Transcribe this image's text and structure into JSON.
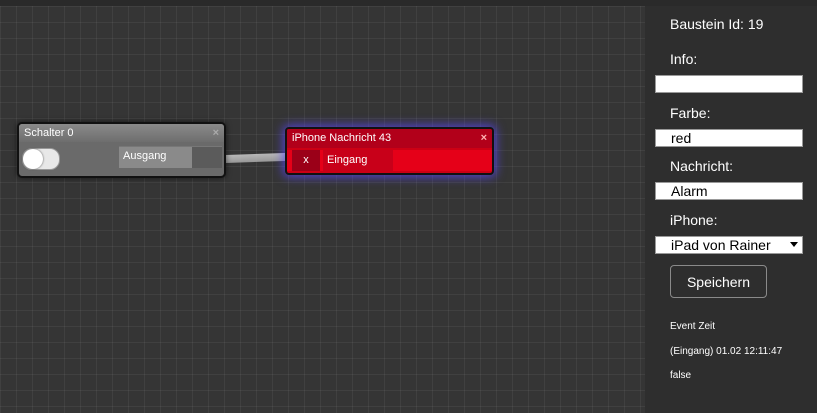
{
  "nodes": {
    "switch": {
      "title": "Schalter 0",
      "close": "×",
      "output_label": "Ausgang",
      "toggle_on": false
    },
    "iphone": {
      "title": "iPhone Nachricht 43",
      "close": "×",
      "remove": "x",
      "input_label": "Eingang"
    }
  },
  "panel": {
    "block_id": "Baustein Id: 19",
    "info_label": "Info:",
    "info_value": "",
    "color_label": "Farbe:",
    "color_value": "red",
    "message_label": "Nachricht:",
    "message_value": "Alarm",
    "iphone_label": "iPhone:",
    "iphone_value": "iPad von Rainer",
    "save_label": "Speichern",
    "event_title": "Event Zeit",
    "event_line": "(Eingang) 01.02 12:11:47",
    "event_value": "false"
  },
  "colors": {
    "node_red": "#cc0014",
    "glow": "#5a46ff",
    "panel_bg": "#2e2e2e",
    "canvas_bg": "#353535"
  }
}
